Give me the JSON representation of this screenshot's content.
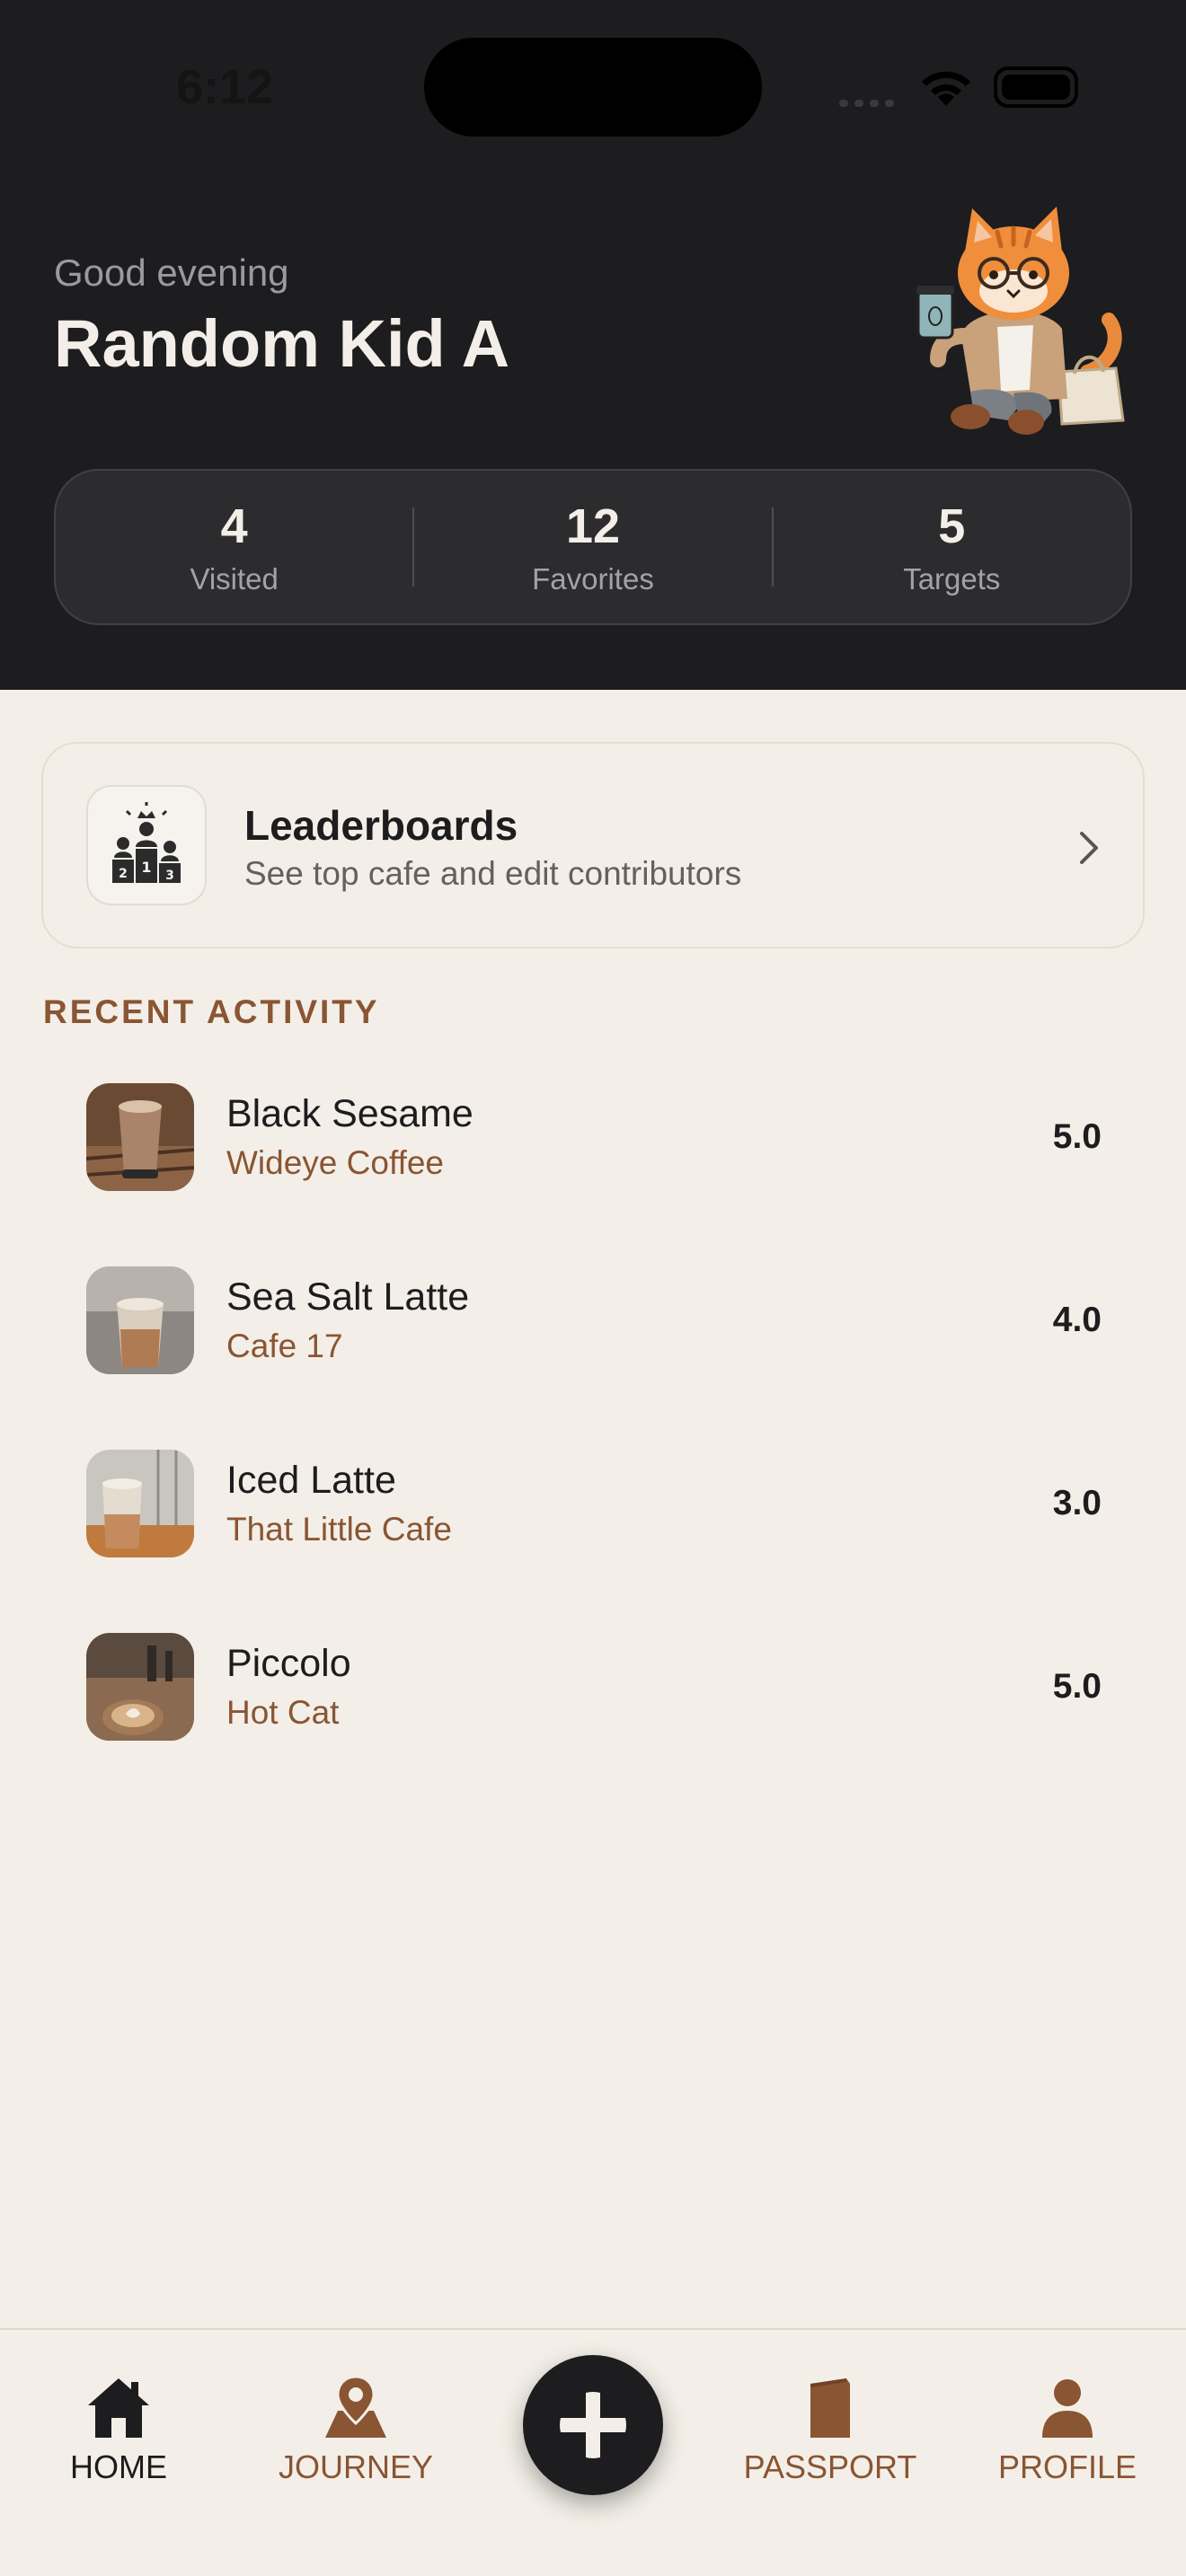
{
  "status_bar": {
    "time": "6:12"
  },
  "header": {
    "greeting": "Good evening",
    "user_name": "Random Kid A",
    "mascot_icon": "cat-with-coffee-illustration"
  },
  "stats": [
    {
      "value": "4",
      "label": "Visited"
    },
    {
      "value": "12",
      "label": "Favorites"
    },
    {
      "value": "5",
      "label": "Targets"
    }
  ],
  "leaderboards": {
    "title": "Leaderboards",
    "subtitle": "See top cafe and edit contributors",
    "icon": "podium-icon"
  },
  "recent_activity": {
    "title": "RECENT ACTIVITY",
    "items": [
      {
        "drink": "Black Sesame",
        "cafe": "Wideye Coffee",
        "rating": "5.0"
      },
      {
        "drink": "Sea Salt Latte",
        "cafe": "Cafe 17",
        "rating": "4.0"
      },
      {
        "drink": "Iced Latte",
        "cafe": "That Little Cafe",
        "rating": "3.0"
      },
      {
        "drink": "Piccolo",
        "cafe": "Hot Cat",
        "rating": "5.0"
      }
    ]
  },
  "tabbar": {
    "tabs": [
      {
        "label": "HOME",
        "icon": "home-icon",
        "active": true
      },
      {
        "label": "JOURNEY",
        "icon": "map-pin-icon",
        "active": false
      },
      {
        "label": "PASSPORT",
        "icon": "passport-icon",
        "active": false
      },
      {
        "label": "PROFILE",
        "icon": "person-icon",
        "active": false
      }
    ],
    "add_icon": "plus-icon"
  },
  "colors": {
    "header_bg": "#1d1c1e",
    "page_bg": "#f3efe8",
    "accent_brown": "#8a5533",
    "active_tab": "#1d1c1e"
  }
}
